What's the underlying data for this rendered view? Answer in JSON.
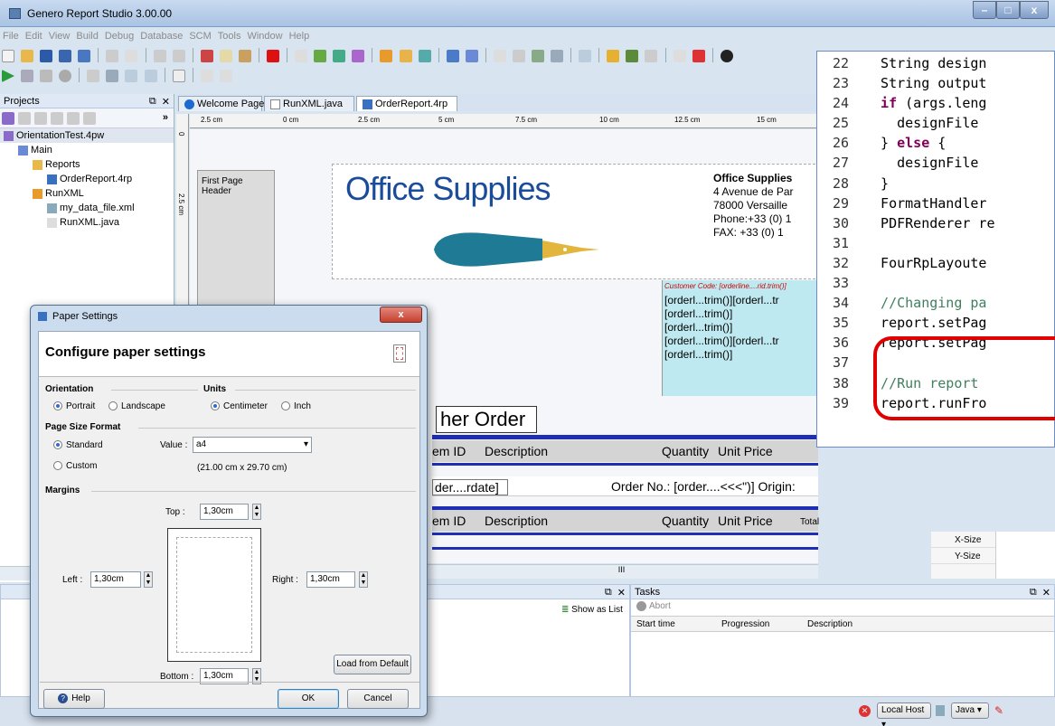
{
  "window": {
    "title": "Genero Report Studio 3.00.00"
  },
  "menu": [
    "File",
    "Edit",
    "View",
    "Build",
    "Debug",
    "Database",
    "SCM",
    "Tools",
    "Window",
    "Help"
  ],
  "projects": {
    "title": "Projects",
    "tree": [
      {
        "label": "OrientationTest.4pw",
        "indent": 0,
        "icon": "workspace-icon"
      },
      {
        "label": "Main",
        "indent": 1,
        "icon": "group-icon"
      },
      {
        "label": "Reports",
        "indent": 2,
        "icon": "folder-icon"
      },
      {
        "label": "OrderReport.4rp",
        "indent": 3,
        "icon": "report-file-icon"
      },
      {
        "label": "RunXML",
        "indent": 2,
        "icon": "program-icon"
      },
      {
        "label": "my_data_file.xml",
        "indent": 3,
        "icon": "xml-file-icon"
      },
      {
        "label": "RunXML.java",
        "indent": 3,
        "icon": "java-file-icon"
      }
    ]
  },
  "tabs": [
    "Welcome Page",
    "RunXML.java",
    "OrderReport.4rp"
  ],
  "ruler": [
    "2.5 cm",
    "0 cm",
    "2.5 cm",
    "5 cm",
    "7.5 cm",
    "10 cm",
    "12.5 cm",
    "15 cm"
  ],
  "vruler": [
    "0",
    "2.5 cm"
  ],
  "report": {
    "first_page_header": "First Page Header",
    "logo": "Office Supplies",
    "company": "Office Supplies",
    "address": [
      "4 Avenue de Par",
      "78000 Versaille",
      "Phone:+33 (0) 1",
      "FAX:   +33 (0) 1"
    ],
    "customer_code": "Customer Code: [orderline....rid.trim()]",
    "order_lines": [
      "[orderl...trim()][orderl...tr",
      "[orderl...trim()]",
      "[orderl...trim()]",
      "[orderl...trim()][orderl...tr",
      "[orderl...trim()]"
    ],
    "order_title": "her Order",
    "col_headers": [
      "em ID",
      "Description",
      "Quantity",
      "Unit Price"
    ],
    "date_field": "der....rdate]",
    "order_no": "Order No.: [order....<<<\")]  Origin:",
    "total": "Total"
  },
  "code": {
    "lines": [
      {
        "n": "22",
        "t": "  String design"
      },
      {
        "n": "23",
        "t": "  String output"
      },
      {
        "n": "24",
        "kw": "  if",
        "t": " (args.leng"
      },
      {
        "n": "25",
        "t": "    designFile"
      },
      {
        "n": "26",
        "t": "  } ",
        "kw2": "else",
        "t2": " {"
      },
      {
        "n": "27",
        "t": "    designFile"
      },
      {
        "n": "28",
        "t": "  }"
      },
      {
        "n": "29",
        "t": "  FormatHandler"
      },
      {
        "n": "30",
        "t": "  PDFRenderer re"
      },
      {
        "n": "31",
        "t": ""
      },
      {
        "n": "32",
        "t": "  FourRpLayoute"
      },
      {
        "n": "33",
        "t": ""
      },
      {
        "n": "34",
        "cm": "  //Changing pa"
      },
      {
        "n": "35",
        "t": "  report.setPag"
      },
      {
        "n": "36",
        "t": "  report.setPag"
      },
      {
        "n": "37",
        "t": ""
      },
      {
        "n": "38",
        "cm": "  //Run report"
      },
      {
        "n": "39",
        "t": "  report.runFro"
      }
    ]
  },
  "props": [
    "X-Size",
    "Y-Size"
  ],
  "tasks": {
    "title": "Tasks",
    "abort": "Abort",
    "columns": [
      "Start time",
      "Progression",
      "Description"
    ]
  },
  "output": {
    "show_as_list": "Show as List"
  },
  "status": {
    "host": "Local Host",
    "lang": "Java"
  },
  "dialog": {
    "title": "Paper Settings",
    "heading": "Configure paper settings",
    "orientation_label": "Orientation",
    "units_label": "Units",
    "portrait": "Portrait",
    "landscape": "Landscape",
    "centimeter": "Centimeter",
    "inch": "Inch",
    "page_size_label": "Page Size Format",
    "standard": "Standard",
    "custom": "Custom",
    "value_label": "Value :",
    "value": "a4",
    "size_text": "(21.00 cm x 29.70 cm)",
    "margins_label": "Margins",
    "top_label": "Top :",
    "top": "1,30cm",
    "left_label": "Left :",
    "left": "1,30cm",
    "right_label": "Right :",
    "right": "1,30cm",
    "bottom_label": "Bottom :",
    "bottom": "1,30cm",
    "load_default": "Load from Default",
    "help": "Help",
    "ok": "OK",
    "cancel": "Cancel"
  },
  "colors": {
    "accent": "#1f2fb5",
    "highlight": "#e10000",
    "selection": "#bfe9f0"
  }
}
